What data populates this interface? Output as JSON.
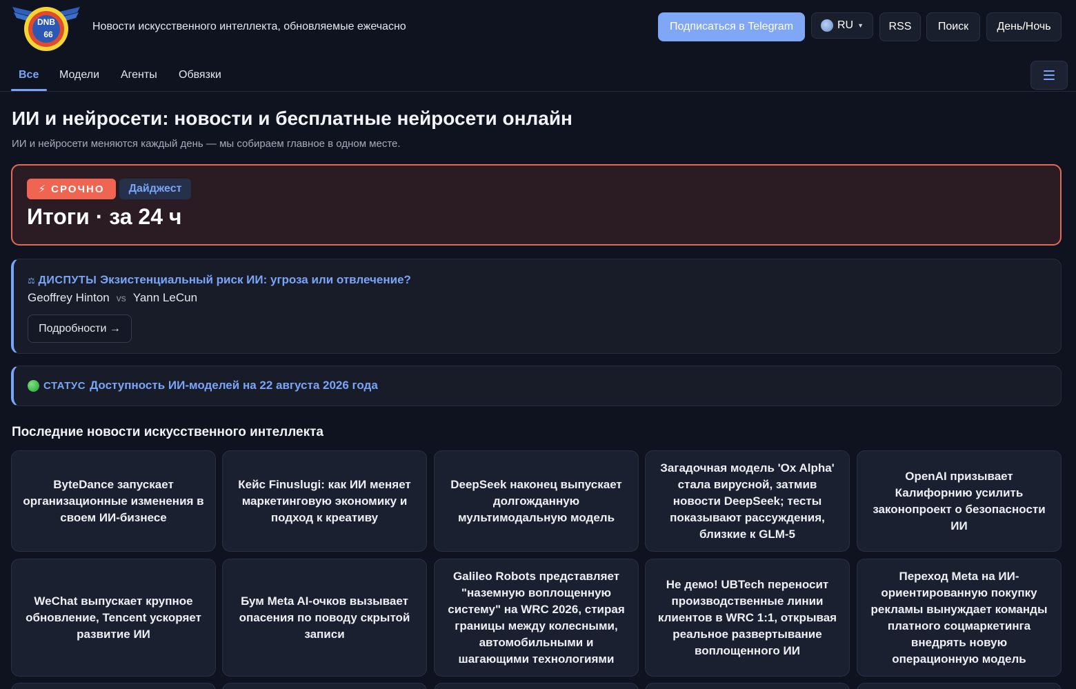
{
  "header": {
    "logo_text_top": "DNB",
    "logo_text_bottom": "66",
    "tagline": "Новости искусственного интеллекта, обновляемые ежечасно",
    "subscribe_label": "Подписаться в Telegram",
    "lang_label": "RU",
    "rss_label": "RSS",
    "search_label": "Поиск",
    "theme_label": "День/Ночь"
  },
  "nav": {
    "tabs": [
      {
        "label": "Все",
        "active": true
      },
      {
        "label": "Модели",
        "active": false
      },
      {
        "label": "Агенты",
        "active": false
      },
      {
        "label": "Обвязки",
        "active": false
      }
    ]
  },
  "page": {
    "title": "ИИ и нейросети: новости и бесплатные нейросети онлайн",
    "subtitle": "ИИ и нейросети меняются каждый день — мы собираем главное в одном месте."
  },
  "urgent": {
    "badge": "⚡ СРОЧНО",
    "tag": "Дайджест",
    "title": "Итоги · за 24 ч"
  },
  "dispute": {
    "icon": "⚖",
    "tag": "ДИСПУТЫ",
    "title": "Экзистенциальный риск ИИ: угроза или отвлечение?",
    "person_a": "Geoffrey Hinton",
    "vs": "vs",
    "person_b": "Yann LeCun",
    "details_label": "Подробности →"
  },
  "status": {
    "tag": "СТАТУС",
    "title": "Доступность ИИ-моделей на 22 августа 2026 года"
  },
  "news": {
    "section_title": "Последние новости искусственного интеллекта",
    "items": [
      "ByteDance запускает организационные изменения в своем ИИ-бизнесе",
      "Кейс Finuslugi: как ИИ меняет маркетинговую экономику и подход к креативу",
      "DeepSeek наконец выпускает долгожданную мультимодальную модель",
      "Загадочная модель 'Ox Alpha' стала вирусной, затмив новости DeepSeek; тесты показывают рассуждения, близкие к GLM-5",
      "OpenAI призывает Калифорнию усилить законопроект о безопасности ИИ",
      "WeChat выпускает крупное обновление, Tencent ускоряет развитие ИИ",
      "Бум Meta AI-очков вызывает опасения по поводу скрытой записи",
      "Galileo Robots представляет \"наземную воплощенную систему\" на WRC 2026, стирая границы между колесными, автомобильными и шагающими технологиями",
      "Не демо! UBTech переносит производственные линии клиентов в WRC 1:1, открывая реальное развертывание воплощенного ИИ",
      "Переход Meta на ИИ-ориентированную покупку рекламы вынуждает команды платного соцмаркетинга внедрять новую операционную модель"
    ]
  }
}
